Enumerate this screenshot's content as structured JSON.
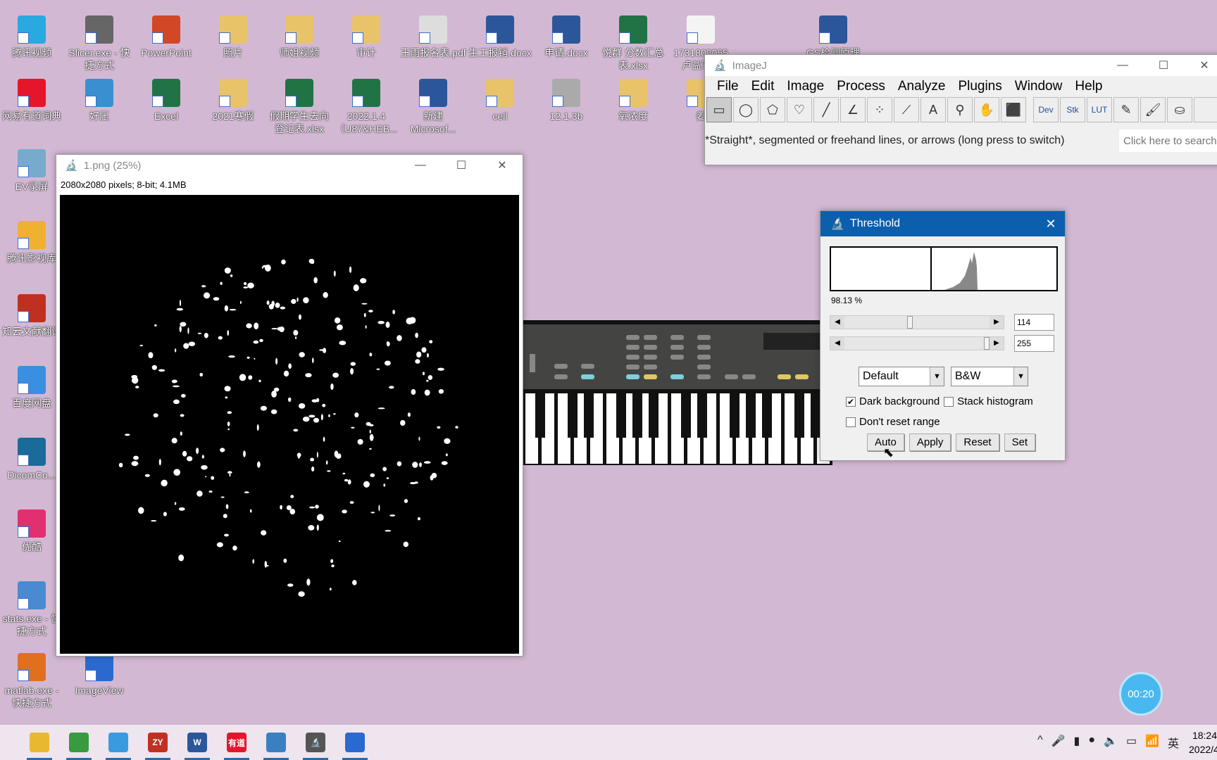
{
  "desktop": {
    "top_row": [
      {
        "label": "腾讯视频",
        "color": "#2aa8e0"
      },
      {
        "label": "Slicer.exe - 快捷方式",
        "color": "#666"
      },
      {
        "label": "PowerPoint",
        "color": "#d24726"
      },
      {
        "label": "照片",
        "color": "#e8c36a"
      },
      {
        "label": "师姐视频",
        "color": "#e8c36a"
      },
      {
        "label": "审计",
        "color": "#e8c36a"
      },
      {
        "label": "王雨报名表.pdf",
        "color": "#ddd"
      },
      {
        "label": "生工报销.docx",
        "color": "#2b579a"
      },
      {
        "label": "申请.docx",
        "color": "#2b579a"
      },
      {
        "label": "悦群 分数汇总表.xlsx",
        "color": "#217346"
      },
      {
        "label": "1731800055 卢益军...",
        "color": "#f4f4f4"
      },
      {
        "label": "GS检测原理",
        "color": "#2b579a"
      }
    ],
    "second_row": [
      {
        "label": "网易有道词典",
        "color": "#e3162b"
      },
      {
        "label": "好压",
        "color": "#3a8fd0"
      },
      {
        "label": "Excel",
        "color": "#217346"
      },
      {
        "label": "2021寒假",
        "color": "#e8c36a"
      },
      {
        "label": "假期学生去向登记表.xlsx",
        "color": "#217346"
      },
      {
        "label": "2022.1.4（U87&HEB...",
        "color": "#217346"
      },
      {
        "label": "新建 Microsof...",
        "color": "#2b579a"
      },
      {
        "label": "cell",
        "color": "#e8c36a"
      },
      {
        "label": "12.1.3b",
        "color": "#aaa"
      },
      {
        "label": "氧浓度",
        "color": "#e8c36a"
      },
      {
        "label": "姜",
        "color": "#e8c36a"
      }
    ],
    "left_column": [
      {
        "label": "EV录屏",
        "color": "#7ac"
      },
      {
        "label": "腾讯影视库",
        "color": "#f0b030"
      },
      {
        "label": "知云文献翻译",
        "color": "#c03020"
      },
      {
        "label": "百度网盘",
        "color": "#3a8fe0"
      },
      {
        "label": "DicomCo...",
        "color": "#1a6a9a"
      },
      {
        "label": "优酷",
        "color": "#e03070"
      },
      {
        "label": "stats.exe - 快捷方式",
        "color": "#4a8ad0"
      },
      {
        "label": "matlab.exe - 快捷方式",
        "color": "#e07020"
      },
      {
        "label": "ImageView",
        "color": "#2a6ad0"
      }
    ]
  },
  "image_window": {
    "title": "1.png (25%)",
    "info": "2080x2080 pixels; 8-bit; 4.1MB",
    "minimize": "—",
    "maximize": "☐",
    "close": "✕"
  },
  "imagej": {
    "title": "ImageJ",
    "menu": [
      "File",
      "Edit",
      "Image",
      "Process",
      "Analyze",
      "Plugins",
      "Window",
      "Help"
    ],
    "tools": [
      "▭",
      "◯",
      "⬠",
      "♡",
      "╱",
      "∠",
      "⁘",
      "⟋",
      "A",
      "⚲",
      "✋",
      "⬛",
      "Dev",
      "Stk",
      "LUT",
      "✎",
      "🖌",
      "⛀",
      ""
    ],
    "status": "*Straight*, segmented or freehand lines, or arrows (long press to switch)",
    "search_placeholder": "Click here to search"
  },
  "threshold": {
    "title": "Threshold",
    "percent": "98.13 %",
    "min": "114",
    "max": "255",
    "min_fraction": 0.447,
    "max_fraction": 1.0,
    "method": "Default",
    "mode": "B&W",
    "dark_background": {
      "label": "Dark background",
      "checked": true
    },
    "stack_histogram": {
      "label": "Stack histogram",
      "checked": false
    },
    "dont_reset": {
      "label": "Don't reset range",
      "checked": false
    },
    "buttons": [
      "Auto",
      "Apply",
      "Reset",
      "Set"
    ]
  },
  "timer": "00:20",
  "taskbar": {
    "apps": [
      {
        "name": "file-explorer",
        "color": "#e8b830",
        "label": ""
      },
      {
        "name": "chrome",
        "color": "#3a9a40",
        "label": ""
      },
      {
        "name": "browser",
        "color": "#3a9ae0",
        "label": ""
      },
      {
        "name": "zhiyun",
        "color": "#c03020",
        "label": "ZY"
      },
      {
        "name": "word",
        "color": "#2b579a",
        "label": "W"
      },
      {
        "name": "youdao",
        "color": "#e3162b",
        "label": "有道"
      },
      {
        "name": "app",
        "color": "#3a80c0",
        "label": ""
      },
      {
        "name": "imagej",
        "color": "#555",
        "label": "🔬"
      },
      {
        "name": "photos",
        "color": "#2a6ad0",
        "label": ""
      }
    ],
    "tray": [
      "^",
      "🎤",
      "▮",
      "●",
      "🔈",
      "▭",
      "📶",
      "英"
    ],
    "time": "18:24",
    "date": "2022/4/"
  }
}
